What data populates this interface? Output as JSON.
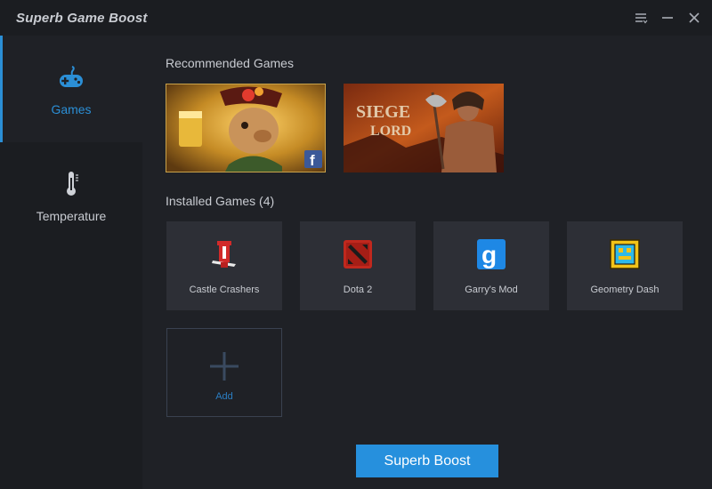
{
  "app": {
    "title": "Superb Game Boost"
  },
  "window_controls": {
    "menu_icon": "menu-lines-icon",
    "minimize_icon": "minimize-icon",
    "close_icon": "close-icon"
  },
  "sidebar": {
    "items": [
      {
        "label": "Games",
        "icon": "gamepad-icon",
        "active": true
      },
      {
        "label": "Temperature",
        "icon": "thermometer-icon",
        "active": false
      }
    ]
  },
  "recommended": {
    "title": "Recommended Games",
    "banners": [
      {
        "name": "pirate-character-banner",
        "badge_icon": "facebook-icon"
      },
      {
        "name": "siege-lord-banner",
        "logo_text": "SIEGE LORD"
      }
    ]
  },
  "installed": {
    "title": "Installed Games (4)",
    "games": [
      {
        "label": "Castle Crashers",
        "icon": "castle-crashers-icon"
      },
      {
        "label": "Dota 2",
        "icon": "dota2-icon"
      },
      {
        "label": "Garry's Mod",
        "icon": "garrys-mod-icon"
      },
      {
        "label": "Geometry Dash",
        "icon": "geometry-dash-icon"
      }
    ],
    "add": {
      "label": "Add",
      "icon": "plus-icon"
    }
  },
  "actions": {
    "boost_label": "Superb Boost"
  },
  "colors": {
    "accent": "#2690dd",
    "background": "#1f2126",
    "sidebar": "#1b1d21",
    "tile": "#2d2f36"
  }
}
